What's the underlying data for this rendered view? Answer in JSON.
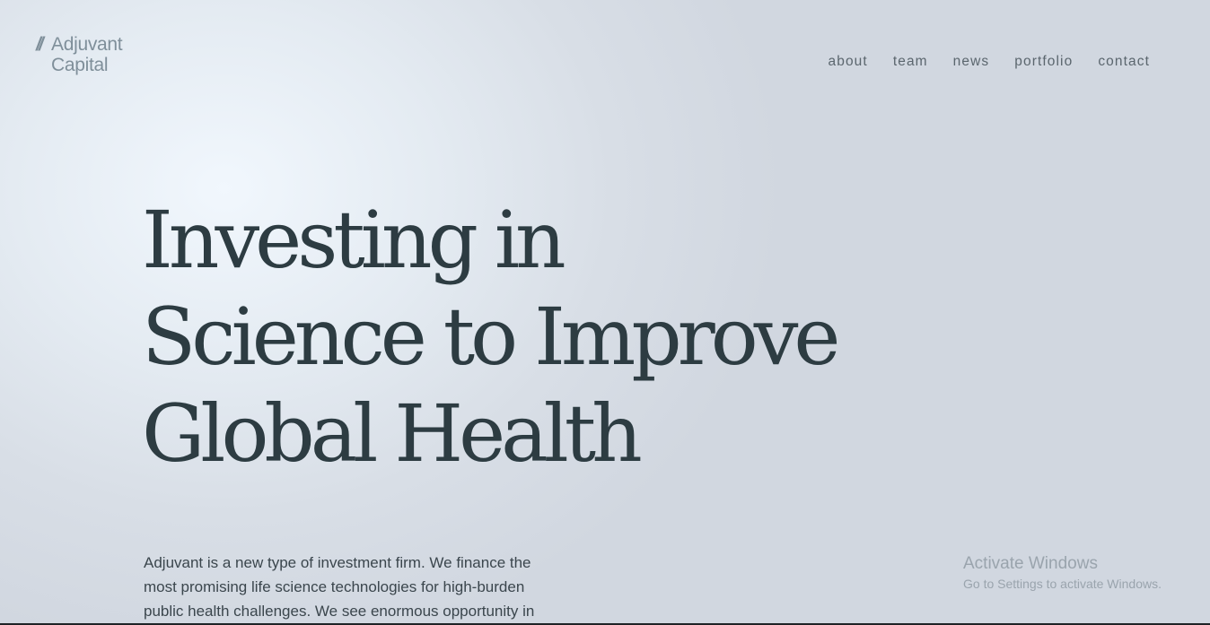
{
  "logo": {
    "slashes": "//",
    "line1": "Adjuvant",
    "line2": "Capital"
  },
  "nav": {
    "items": [
      {
        "label": "about"
      },
      {
        "label": "team"
      },
      {
        "label": "news"
      },
      {
        "label": "portfolio"
      },
      {
        "label": "contact"
      }
    ]
  },
  "hero": {
    "heading_lines": [
      "Investing in",
      "Science to Improve",
      "Global Health"
    ],
    "body_lines": [
      "Adjuvant is a new type of investment firm. We finance the",
      "most promising life science technologies for high-burden",
      "public health challenges. We see enormous opportunity in"
    ]
  },
  "os_watermark": {
    "title": "Activate Windows",
    "subtitle": "Go to Settings to activate Windows."
  },
  "colors": {
    "heading": "#2d3c42",
    "nav_text": "#5b666e",
    "logo": "#7f8f9a",
    "background": "#d8dee6"
  }
}
